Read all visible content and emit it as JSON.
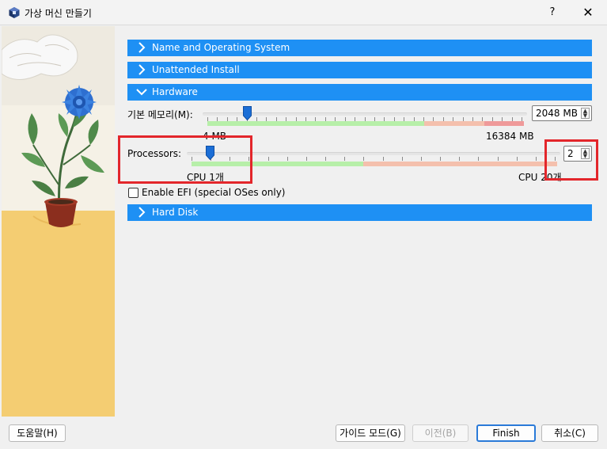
{
  "window": {
    "title": "가상 머신 만들기",
    "help_label": "?",
    "close_label": "✕"
  },
  "sections": {
    "name_os": "Name and Operating System",
    "unattended": "Unattended Install",
    "hardware": "Hardware",
    "hard_disk": "Hard Disk"
  },
  "memory": {
    "label": "기본 메모리(M):",
    "value": "2048 MB",
    "min_label": "4 MB",
    "max_label": "16384 MB",
    "level": 0.125
  },
  "processors": {
    "label": "Processors:",
    "value": "2",
    "min_label": "CPU 1개",
    "max_label": "CPU 20개",
    "level": 0.05
  },
  "efi": {
    "label": "Enable EFI (special OSes only)",
    "checked": false
  },
  "buttons": {
    "help": "도움말(H)",
    "guided_mode": "가이드 모드(G)",
    "back": "이전(B)",
    "finish": "Finish",
    "cancel": "취소(C)"
  },
  "colors": {
    "section_header": "#1e90f4",
    "highlight_box": "#e3262b",
    "ok_range": "#b7efa9",
    "warn_range": "#f4c0ad",
    "bad_range": "#ef9a9a"
  },
  "icons": {
    "app": "virtualbox-icon",
    "collapsed": "chevron-right-icon",
    "expanded": "chevron-down-icon",
    "spin": "spin-arrows-icon",
    "slider": "slider-thumb-icon"
  }
}
